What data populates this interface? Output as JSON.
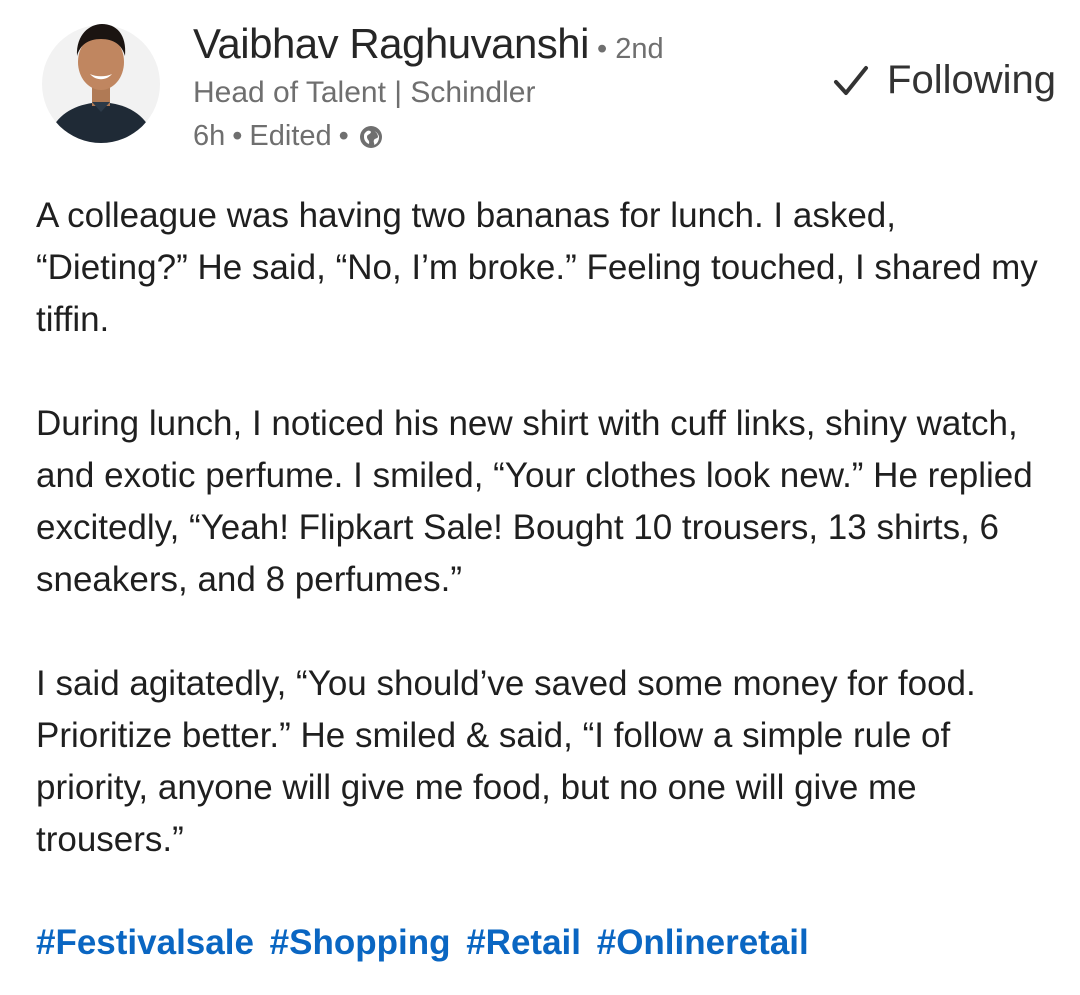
{
  "author": {
    "name": "Vaibhav Raghuvanshi",
    "degree": "• 2nd",
    "headline": "Head of Talent | Schindler",
    "time": "6h",
    "edited": "Edited",
    "visibility_icon": "globe-icon"
  },
  "follow_button": {
    "label": "Following",
    "icon": "check-icon"
  },
  "post": {
    "paragraphs": [
      "A colleague was having two bananas for lunch. I asked, “Dieting?” He said, “No, I’m broke.” Feeling touched, I shared my tiffin.",
      "During lunch, I noticed his new shirt with cuff links, shiny watch, and exotic perfume. I smiled, “Your clothes look new.” He replied excitedly, “Yeah! Flipkart Sale! Bought 10 trousers, 13 shirts, 6 sneakers, and 8 perfumes.”",
      "I said agitatedly, “You should’ve saved some money for food. Prioritize better.” He smiled & said, “I follow a simple rule of priority, anyone will give me food, but no one will give me trousers.”"
    ],
    "hashtags": [
      "#Festivalsale",
      "#Shopping",
      "#Retail",
      "#Onlineretail"
    ]
  },
  "colors": {
    "hashtag": "#0a66c2",
    "secondary_text": "#6f6f6f",
    "primary_text": "#1f1f1f"
  }
}
